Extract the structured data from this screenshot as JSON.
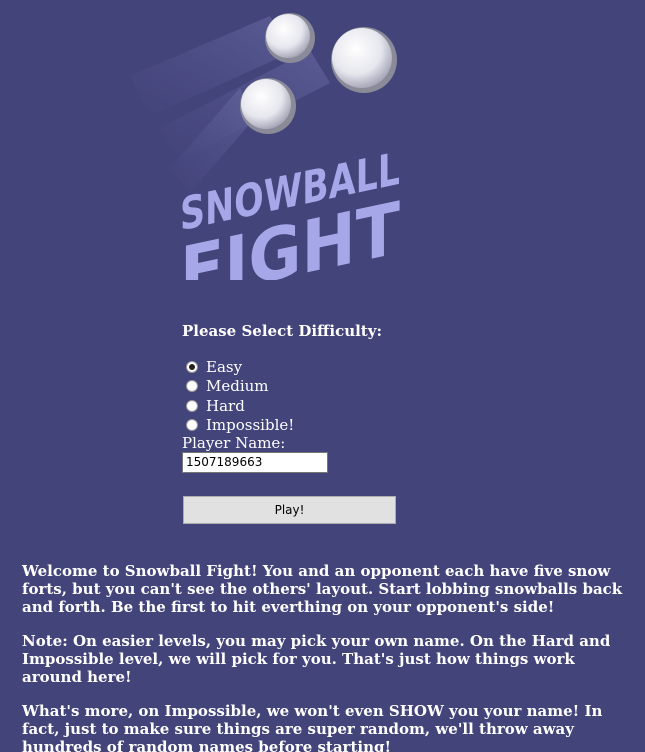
{
  "logo": {
    "line1": "SNOWBALL",
    "line2": "FIGHT",
    "text_color": "#a6a7e8",
    "snow_color": "#f3f3f8"
  },
  "difficulty": {
    "title": "Please Select Difficulty:",
    "options": [
      {
        "label": "Easy",
        "selected": true
      },
      {
        "label": "Medium",
        "selected": false
      },
      {
        "label": "Hard",
        "selected": false
      },
      {
        "label": "Impossible!",
        "selected": false
      }
    ]
  },
  "player": {
    "label": "Player Name:",
    "value": "1507189663"
  },
  "play_button": {
    "label": "Play!"
  },
  "info": {
    "intro": "Welcome to Snowball Fight! You and an opponent each have five snow forts, but you can't see the others' layout. Start lobbing snowballs back and forth. Be the first to hit everthing on your opponent's side!",
    "note": "Note: On easier levels, you may pick your own name. On the Hard and Impossible level, we will pick for you. That's just how things work around here!",
    "more": "What's more, on Impossible, we won't even SHOW you your name! In fact, just to make sure things are super random, we'll throw away hundreds of random names before starting!"
  },
  "colors": {
    "background": "#43447a",
    "logo_text": "#a6a7e8"
  }
}
